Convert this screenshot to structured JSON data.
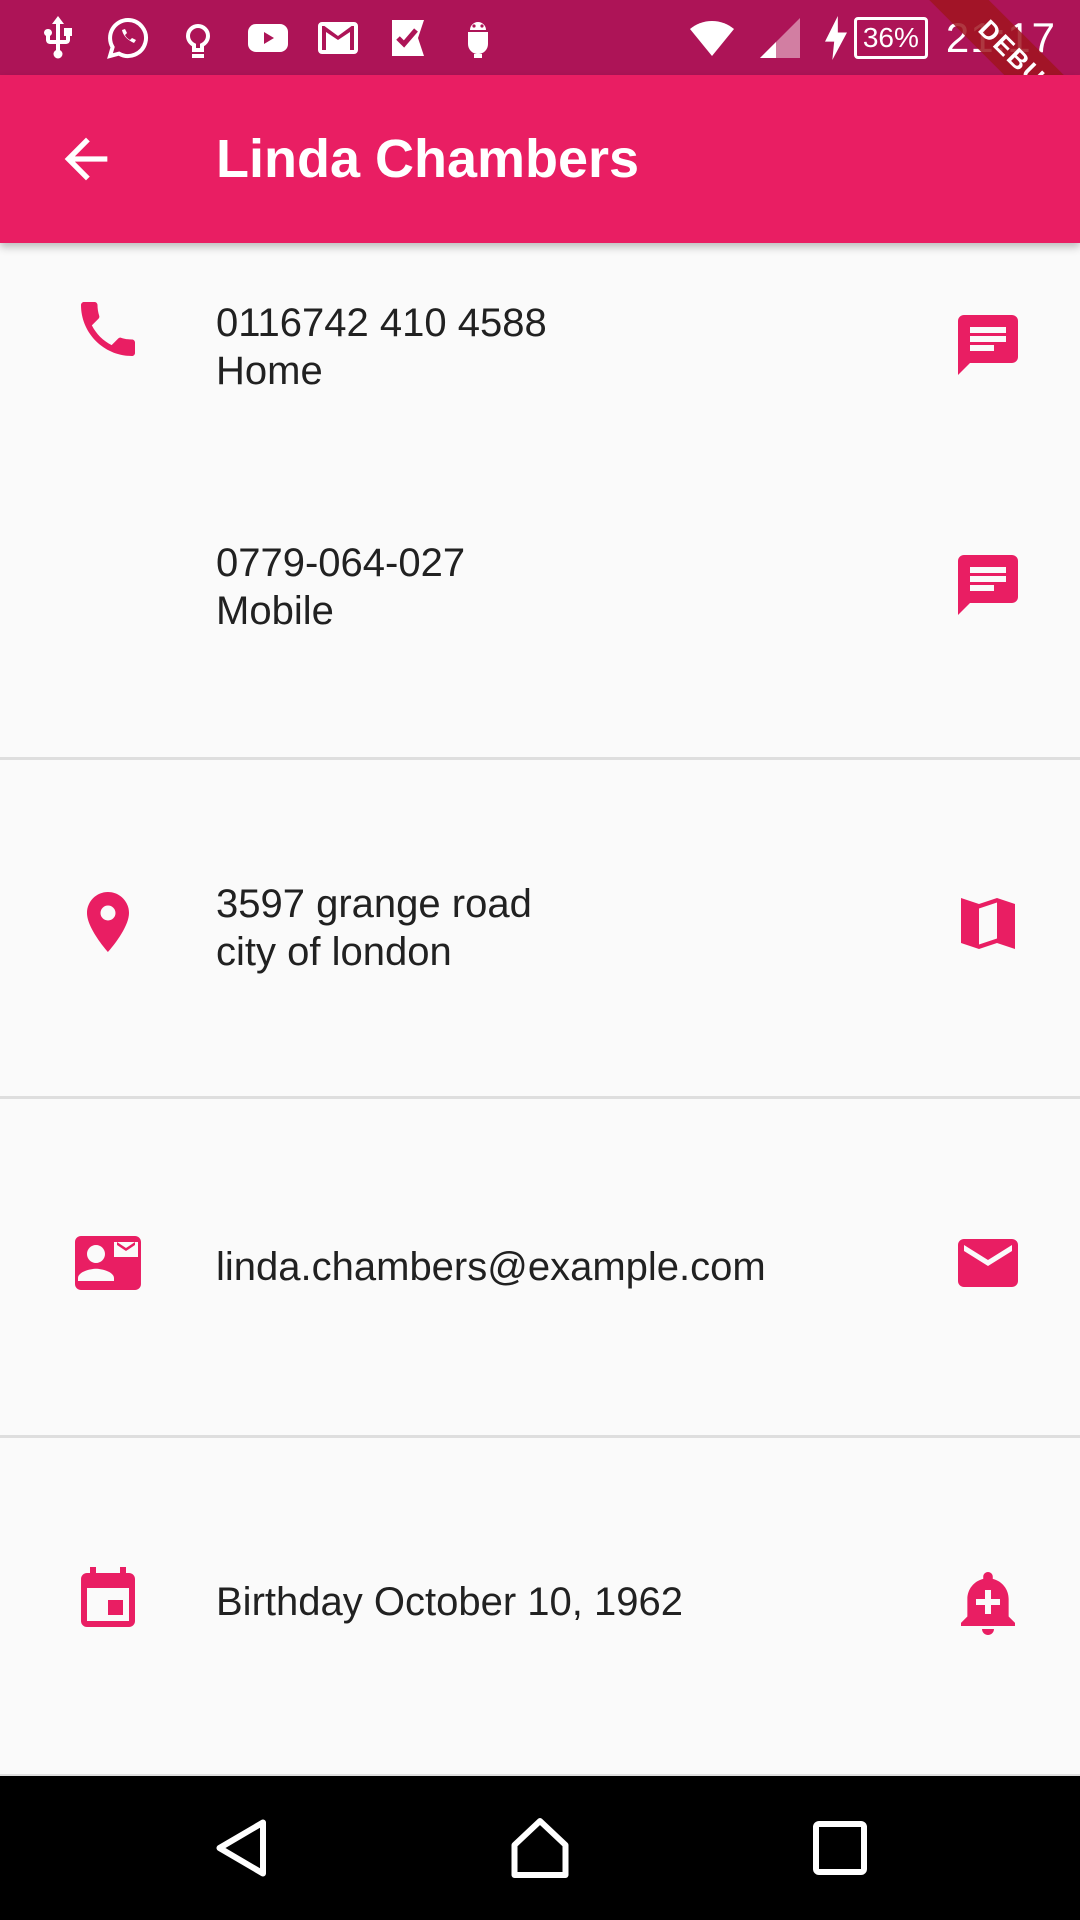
{
  "status_bar": {
    "time": "21:17",
    "battery": "36%",
    "debug_label": "DEBUG"
  },
  "app_bar": {
    "title": "Linda Chambers"
  },
  "phones": [
    {
      "number": "0116742 410 4588",
      "type": "Home"
    },
    {
      "number": "0779-064-027",
      "type": "Mobile"
    }
  ],
  "address": {
    "line1": "3597 grange road",
    "line2": "city of london"
  },
  "email": {
    "address": "linda.chambers@example.com"
  },
  "birthday": {
    "text": "Birthday October 10, 1962"
  },
  "theme": {
    "accent": "#e91e63",
    "status_bar": "#ad1457"
  },
  "icons": {
    "phone": "phone-icon",
    "message": "message-icon",
    "location": "location-pin-icon",
    "map": "map-icon",
    "contact_mail": "contact-mail-icon",
    "email": "email-icon",
    "calendar": "calendar-icon",
    "alarm_add": "bell-add-icon"
  }
}
